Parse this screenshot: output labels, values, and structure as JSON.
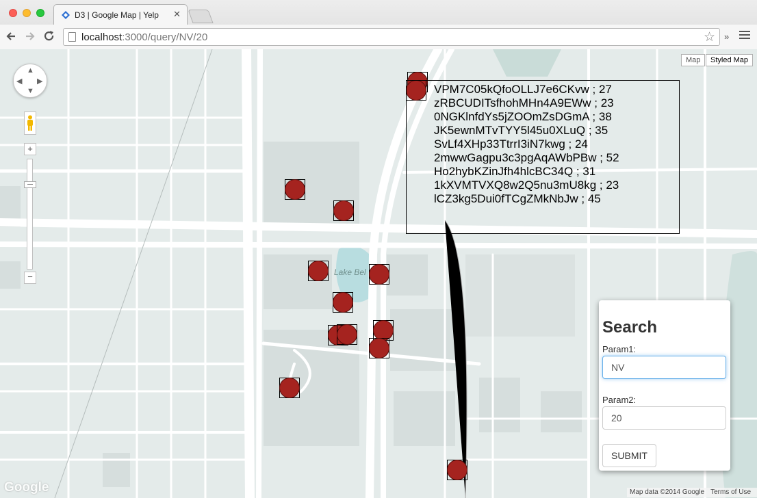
{
  "browser": {
    "tab_title": "D3 | Google Map | Yelp",
    "tab_close": "✕",
    "url_host": "localhost",
    "url_path": ":3000/query/NV/20",
    "back_icon": "arrow-left-icon",
    "forward_icon": "arrow-right-icon",
    "reload_icon": "reload-icon",
    "bookmark_icon": "star-icon",
    "extensions_label": "»"
  },
  "map": {
    "type_map_label": "Map",
    "type_styled_label": "Styled Map",
    "zoom_in_label": "+",
    "zoom_out_label": "−",
    "lake_label": "Lake Bel",
    "logo_text": "Google",
    "attribution_data": "Map data ©2014 Google",
    "attribution_terms": "Terms of Use",
    "marker_color": "#a5231f"
  },
  "tooltip": {
    "lines": [
      "VPM7C05kQfoOLLJ7e6CKvw ; 27",
      "zRBCUDITsfhohMHn4A9EWw ; 23",
      "0NGKlnfdYs5jZOOmZsDGmA ; 38",
      "JK5ewnMTvTYY5l45u0XLuQ ; 35",
      "SvLf4XHp33TtrrI3iN7kwg ; 24",
      "2mwwGagpu3c3pgAqAWbPBw ; 52",
      "Ho2hybKZinJfh4hlcBC34Q ; 31",
      "1kXVMTVXQ8w2Q5nu3mU8kg ; 23",
      "lCZ3kg5Dui0fTCgZMkNbJw ; 45"
    ]
  },
  "search": {
    "title": "Search",
    "param1_label": "Param1:",
    "param1_value": "NV",
    "param2_label": "Param2:",
    "param2_value": "20",
    "submit_label": "SUBMIT"
  }
}
